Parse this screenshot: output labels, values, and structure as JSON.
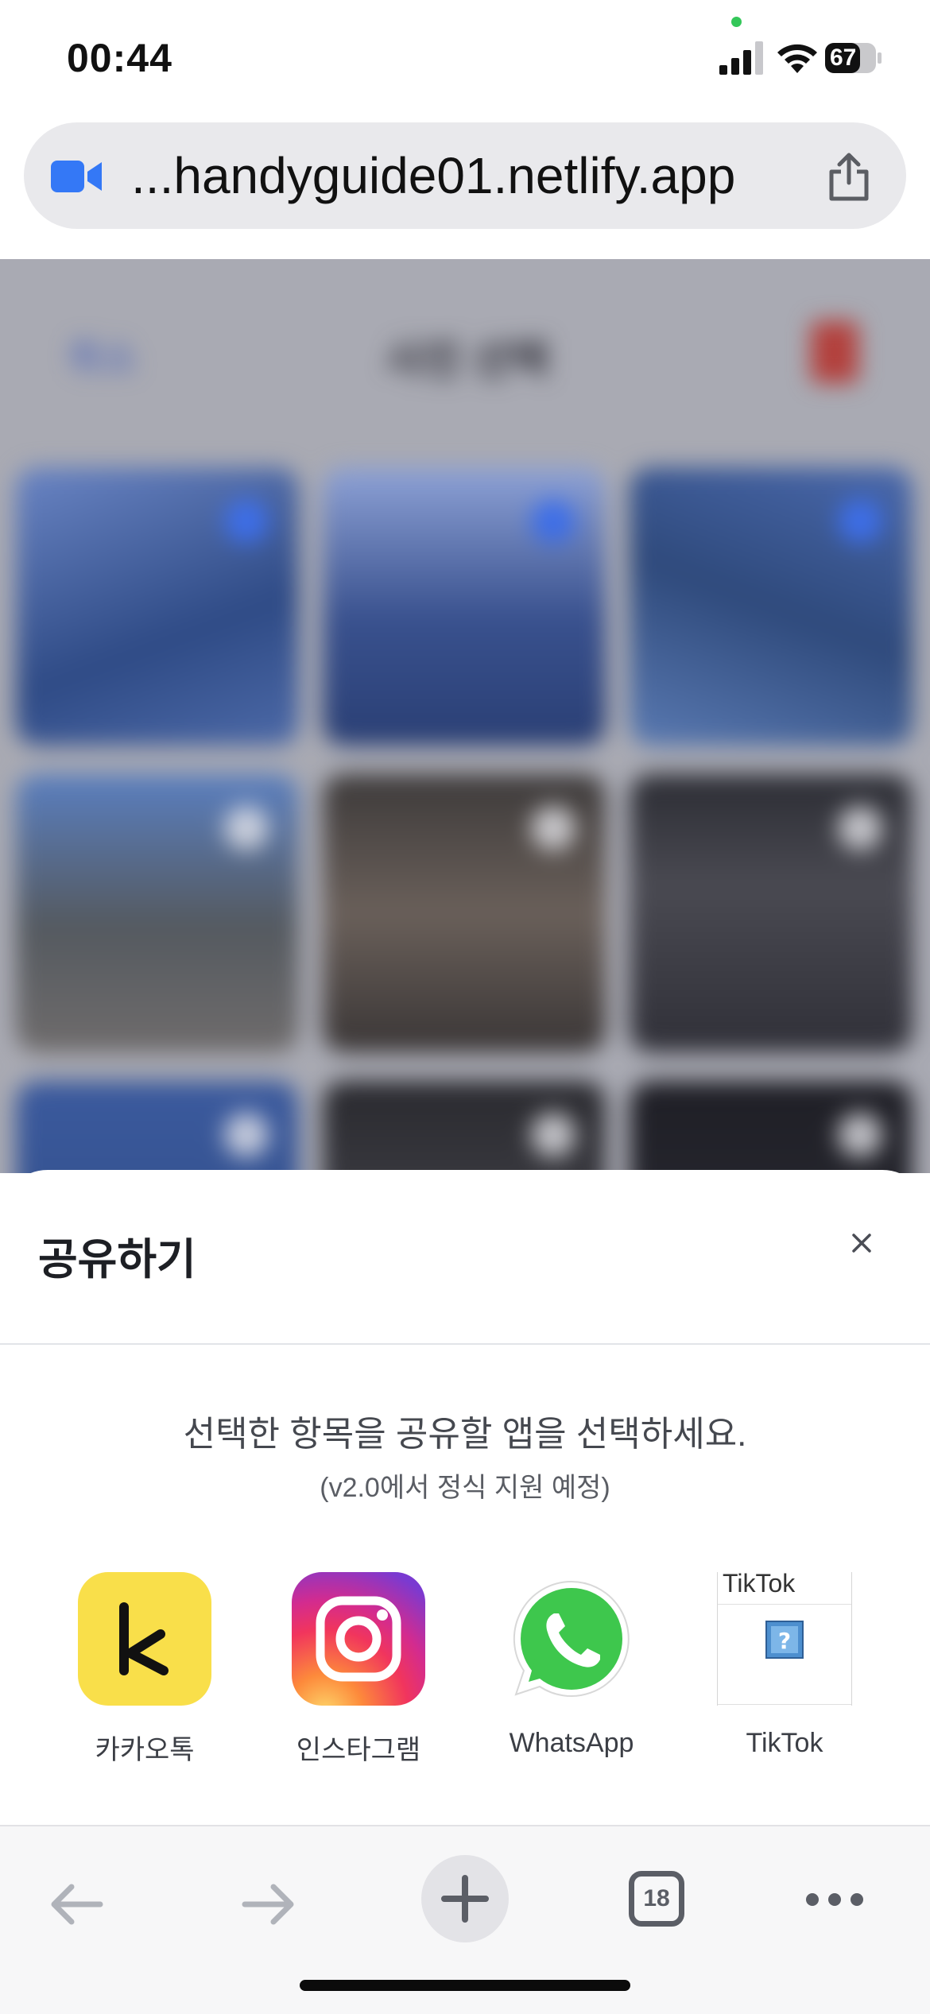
{
  "status_bar": {
    "time": "00:44",
    "battery": "67"
  },
  "url_bar": {
    "url": "...handyguide01.netlify.app"
  },
  "page_header": {
    "left_label": "취소",
    "title": "사진 선택"
  },
  "share_sheet": {
    "title": "공유하기",
    "description": "선택한 항목을 공유할 앱을 선택하세요.",
    "note": "(v2.0에서 정식 지원 예정)",
    "apps": [
      {
        "label": "카카오톡",
        "icon": "kakaotalk-icon",
        "color": "#f9df4a"
      },
      {
        "label": "인스타그램",
        "icon": "instagram-icon",
        "color": "#e1306c"
      },
      {
        "label": "WhatsApp",
        "icon": "whatsapp-icon",
        "color": "#3ec74d"
      },
      {
        "label": "TikTok",
        "icon": "tiktok-broken-image-icon",
        "alt_text": "TikTok"
      }
    ]
  },
  "toolbar": {
    "tab_count": "18"
  }
}
